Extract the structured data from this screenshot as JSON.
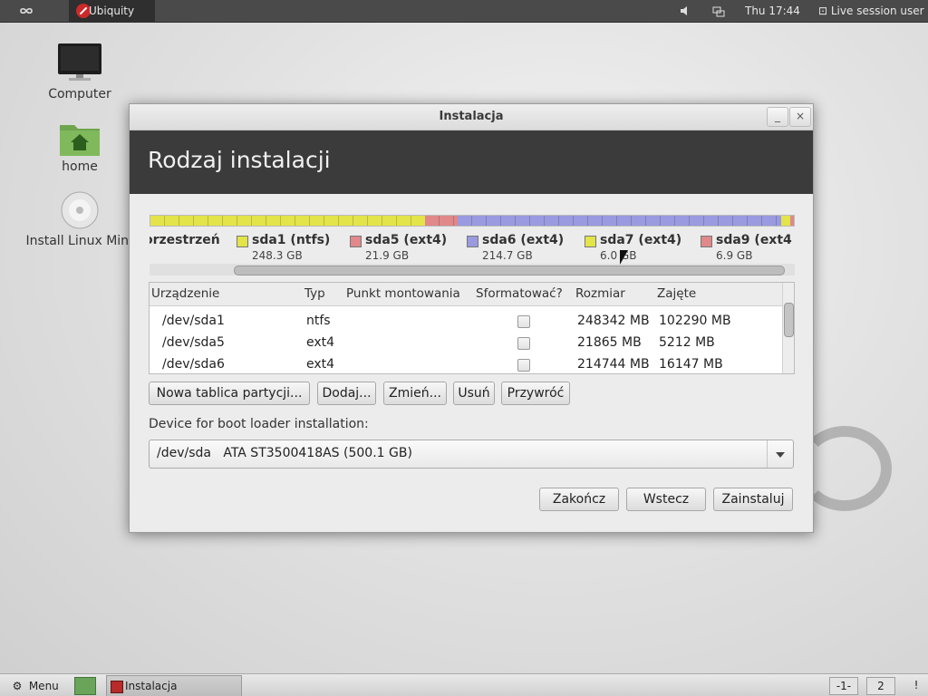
{
  "top_panel": {
    "logo_icon": "infinity-icon",
    "app_label": "Ubiquity",
    "volume_icon": "volume-icon",
    "network_icon": "network-icon",
    "clock": "Thu 17:44",
    "user_label": "Live session user"
  },
  "desktop": {
    "icons": [
      {
        "label": "Computer",
        "icon": "monitor-icon"
      },
      {
        "label": "home",
        "icon": "home-folder-icon"
      },
      {
        "label": "Install Linux Mint",
        "icon": "cd-disc-icon"
      }
    ]
  },
  "window": {
    "title": "Instalacja",
    "minimize": "_",
    "close": "×",
    "header": "Rodzaj instalacji",
    "partition_bar": {
      "colors": {
        "yellow": "#e3e34a",
        "red": "#e0888a",
        "blue": "#9a9ae0"
      },
      "segments_pct": [
        {
          "color": "#e3e34a",
          "pct": 42.7
        },
        {
          "color": "#e0888a",
          "pct": 5.0
        },
        {
          "color": "#9a9ae0",
          "pct": 50.3
        },
        {
          "color": "#e3e34a",
          "pct": 1.5
        },
        {
          "color": "#e0888a",
          "pct": 0.5
        }
      ]
    },
    "legend": [
      {
        "name": "orzestrzeń",
        "size": "",
        "color": ""
      },
      {
        "name": "sda1 (ntfs)",
        "size": "248.3 GB",
        "color": "#e3e34a"
      },
      {
        "name": "sda5 (ext4)",
        "size": "21.9 GB",
        "color": "#e0888a"
      },
      {
        "name": "sda6 (ext4)",
        "size": "214.7 GB",
        "color": "#9a9ae0"
      },
      {
        "name": "sda7 (ext4)",
        "size": "6.0 GB",
        "color": "#e3e34a"
      },
      {
        "name": "sda9 (ext4",
        "size": "6.9 GB",
        "color": "#e0888a"
      }
    ],
    "table": {
      "headers": [
        "Urządzenie",
        "Typ",
        "Punkt montowania",
        "Sformatować?",
        "Rozmiar",
        "Zajęte"
      ],
      "rows": [
        {
          "device": "/dev/sda1",
          "type": "ntfs",
          "mount": "",
          "size": "248342 MB",
          "used": "102290 MB"
        },
        {
          "device": "/dev/sda5",
          "type": "ext4",
          "mount": "",
          "size": "21865 MB",
          "used": "5212 MB"
        },
        {
          "device": "/dev/sda6",
          "type": "ext4",
          "mount": "",
          "size": "214744 MB",
          "used": "16147 MB"
        }
      ]
    },
    "buttons": {
      "new_table": "Nowa tablica partycji...",
      "add": "Dodaj...",
      "change": "Zmień...",
      "delete": "Usuń",
      "revert": "Przywróć"
    },
    "bootloader": {
      "label": "Device for boot loader installation:",
      "selected": "/dev/sda   ATA ST3500418AS (500.1 GB)"
    },
    "footer": {
      "quit": "Zakończ",
      "back": "Wstecz",
      "install": "Zainstaluj"
    }
  },
  "taskbar": {
    "menu_label": "Menu",
    "task_label": "Instalacja",
    "workspaces": [
      "-1-",
      "2"
    ],
    "info": "!"
  }
}
